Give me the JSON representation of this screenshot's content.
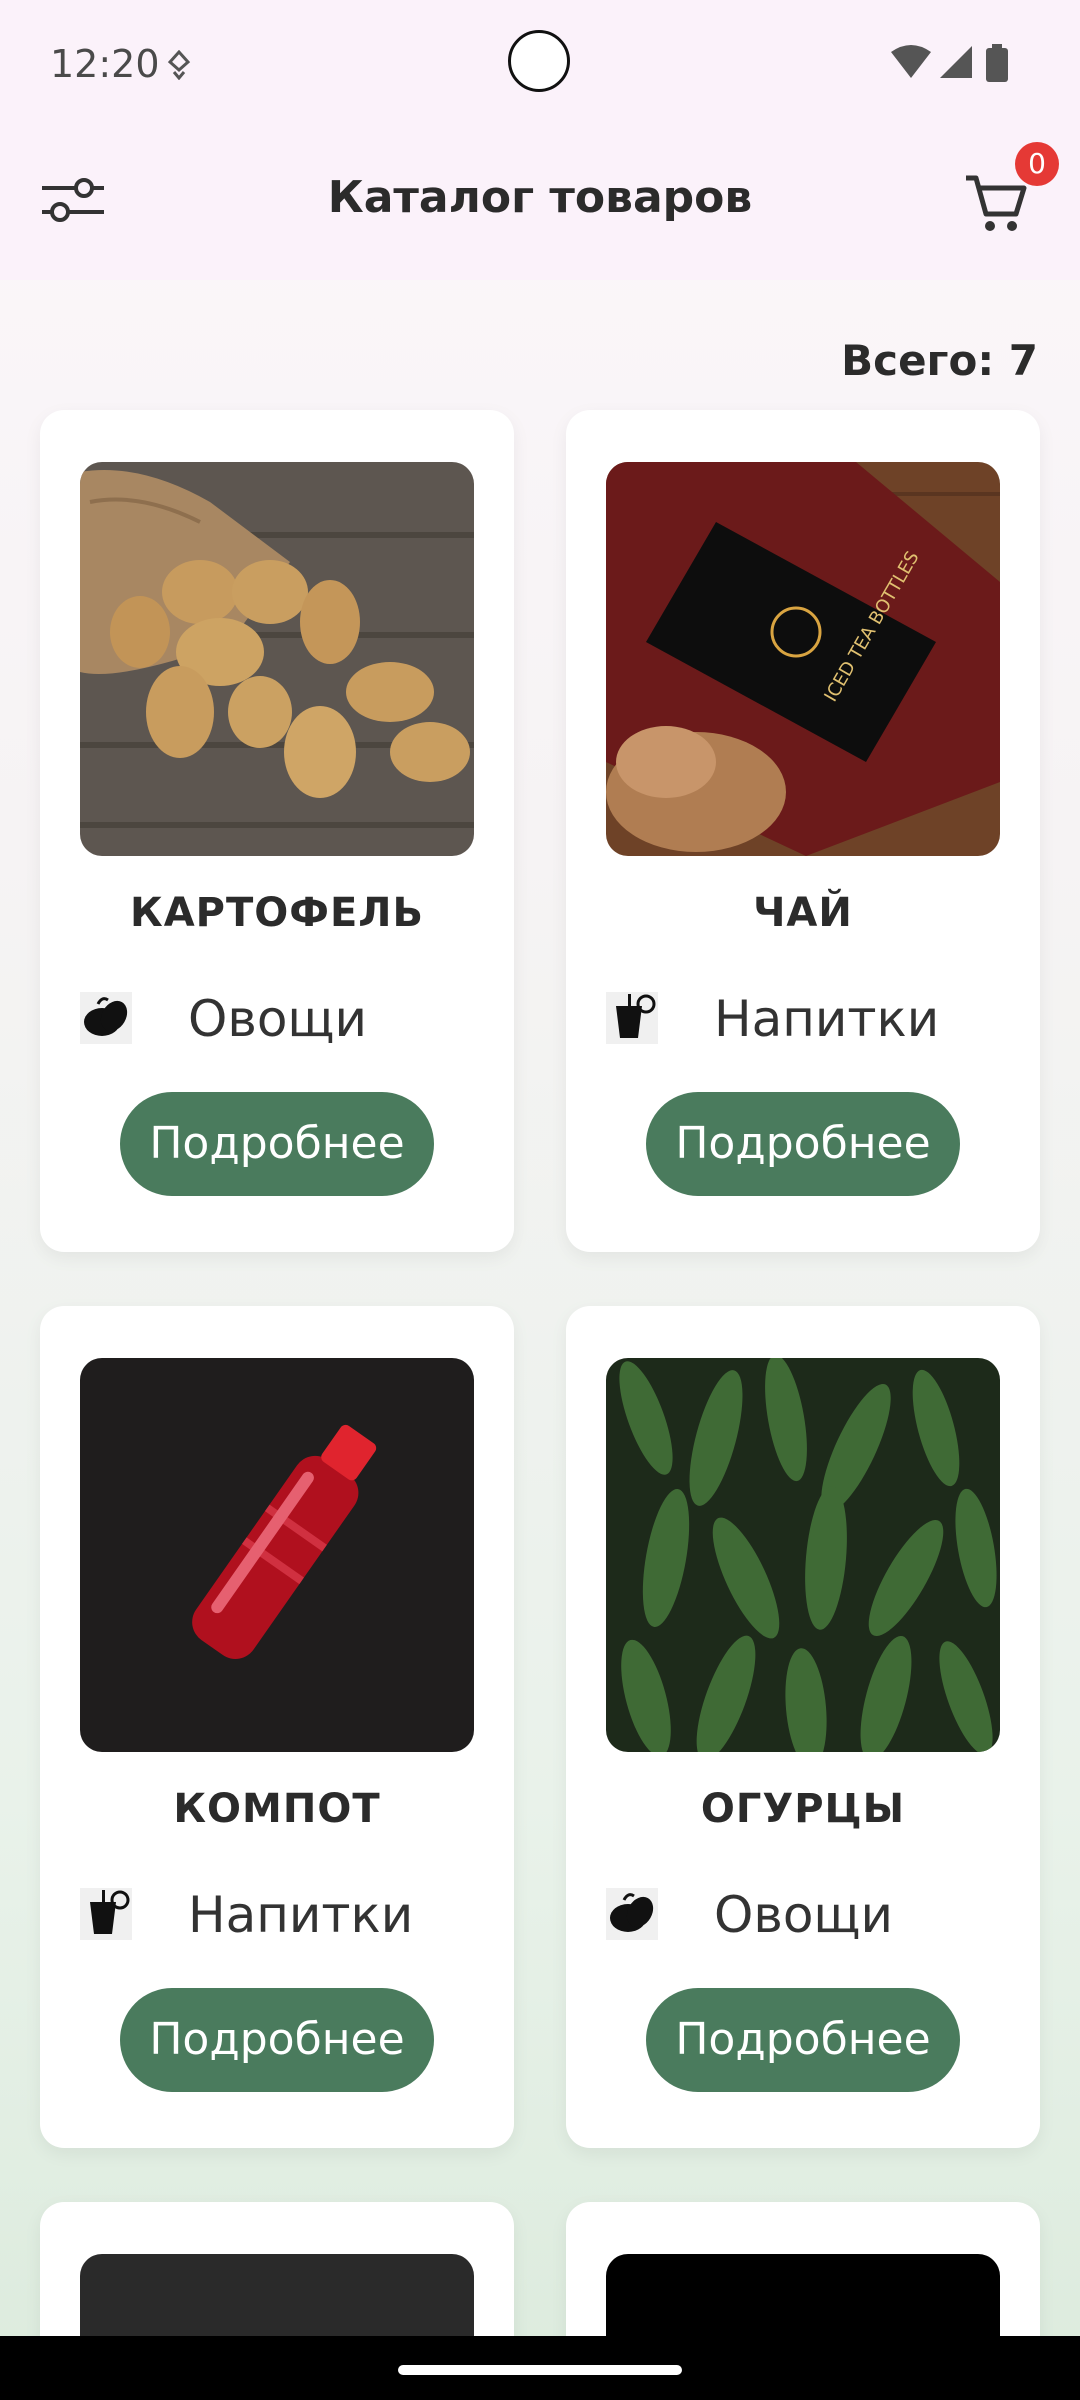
{
  "status_bar": {
    "time": "12:20"
  },
  "header": {
    "title": "Каталог товаров",
    "cart_count": "0"
  },
  "summary": {
    "total_label": "Всего: 7"
  },
  "products": [
    {
      "name": "КАРТОФЕЛЬ",
      "category": "Овощи",
      "category_icon": "vegetables-icon",
      "button": "Подробнее"
    },
    {
      "name": "ЧАЙ",
      "category": "Напитки",
      "category_icon": "drinks-icon",
      "button": "Подробнее"
    },
    {
      "name": "КОМПОТ",
      "category": "Напитки",
      "category_icon": "drinks-icon",
      "button": "Подробнее"
    },
    {
      "name": "ОГУРЦЫ",
      "category": "Овощи",
      "category_icon": "vegetables-icon",
      "button": "Подробнее"
    }
  ],
  "colors": {
    "accent": "#4a7b5d",
    "badge": "#e53935"
  }
}
